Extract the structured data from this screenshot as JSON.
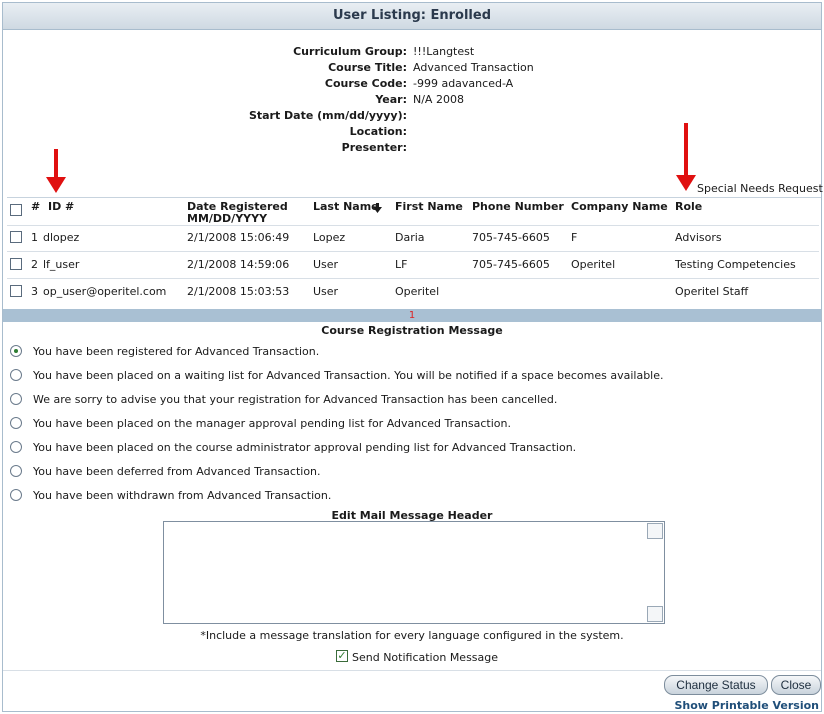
{
  "title": "User Listing: Enrolled",
  "info": [
    {
      "label": "Curriculum Group:",
      "value": "!!!Langtest"
    },
    {
      "label": "Course Title:",
      "value": "Advanced Transaction"
    },
    {
      "label": "Course Code:",
      "value": "-999 adavanced-A"
    },
    {
      "label": "Year:",
      "value": "N/A 2008"
    },
    {
      "label": "Start Date (mm/dd/yyyy):",
      "value": ""
    },
    {
      "label": "Location:",
      "value": ""
    },
    {
      "label": "Presenter:",
      "value": ""
    }
  ],
  "special_needs_label": "Special Needs Request",
  "table": {
    "headers": {
      "num": "#",
      "id": "ID #",
      "date_line1": "Date Registered",
      "date_line2": "MM/DD/YYYY",
      "last_name": "Last Name",
      "first_name": "First Name",
      "phone": "Phone Number",
      "company": "Company Name",
      "role": "Role"
    },
    "rows": [
      {
        "num": "1",
        "id": "dlopez",
        "date": "2/1/2008 15:06:49",
        "last_name": "Lopez",
        "first_name": "Daria",
        "phone": "705-745-6605",
        "company": "F",
        "role": "Advisors"
      },
      {
        "num": "2",
        "id": "lf_user",
        "date": "2/1/2008 14:59:06",
        "last_name": "User",
        "first_name": "LF",
        "phone": "705-745-6605",
        "company": "Operitel",
        "role": "Testing Competencies"
      },
      {
        "num": "3",
        "id": "op_user@operitel.com",
        "date": "2/1/2008 15:03:53",
        "last_name": "User",
        "first_name": "Operitel",
        "phone": "",
        "company": "",
        "role": "Operitel Staff"
      }
    ]
  },
  "pager": {
    "current_page": "1"
  },
  "registration_message": {
    "title": "Course Registration Message",
    "options": [
      "You have been registered for Advanced Transaction.",
      "You have been placed on a waiting list for Advanced Transaction. You will be notified if a space becomes available.",
      "We are sorry to advise you that your registration for Advanced Transaction has been cancelled.",
      "You have been placed on the manager approval pending list for Advanced Transaction.",
      "You have been placed on the course administrator approval pending list for Advanced Transaction.",
      "You have been deferred from Advanced Transaction.",
      "You have been withdrawn from Advanced Transaction."
    ],
    "selected_index": 0
  },
  "mail_header": {
    "title": "Edit Mail Message Header",
    "value": "",
    "note": "*Include a message translation for every language configured in the system."
  },
  "send_notification_label": "Send Notification Message",
  "send_notification_checked": true,
  "buttons": {
    "change_status": "Change Status",
    "close": "Close"
  },
  "show_printable_label": "Show Printable Version",
  "colors": {
    "accent_arrow": "#e01010",
    "pager_bar": "#a9c0d3",
    "title_text": "#2b3a4d"
  }
}
